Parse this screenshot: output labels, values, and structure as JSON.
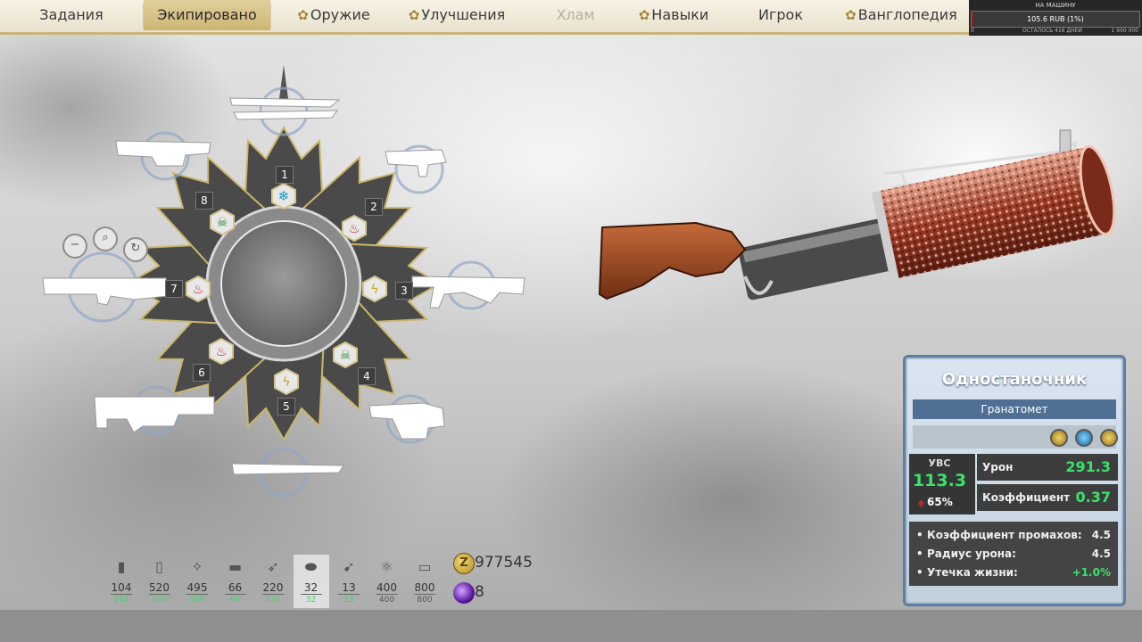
{
  "nav": {
    "tabs": [
      {
        "label": "Задания",
        "icon": ""
      },
      {
        "label": "Экипировано",
        "icon": ""
      },
      {
        "label": "Оружие",
        "icon": "gear-icon"
      },
      {
        "label": "Улучшения",
        "icon": "gear-icon"
      },
      {
        "label": "Хлам",
        "icon": ""
      },
      {
        "label": "Навыки",
        "icon": "gear-icon"
      },
      {
        "label": "Игрок",
        "icon": ""
      },
      {
        "label": "Ванглопедия",
        "icon": "gear-icon"
      }
    ],
    "active": "Экипировано",
    "disabled": "Хлам"
  },
  "donation": {
    "title": "НА МАШИНУ",
    "amount_text": "105.6 RUB (1%)",
    "progress": 0.01,
    "left_value": "0",
    "middle_text": "ОСТАЛОСЬ 416 ДНЕЙ",
    "right_value": "1 900 000",
    "fill_color": "#8b1c1c"
  },
  "wheel": {
    "slots": [
      "1",
      "2",
      "3",
      "4",
      "5",
      "6",
      "7",
      "8"
    ],
    "element_icons": [
      "snowflake-icon",
      "fire-icon",
      "lightning-icon",
      "skull-icon",
      "lightning-icon",
      "fire-icon",
      "fire-icon",
      "skull-icon"
    ],
    "side_buttons": [
      "minus-icon",
      "magnifier-icon",
      "refresh-icon"
    ]
  },
  "weapon": {
    "name": "Одностаночник",
    "type": "Гранатомет",
    "chips": [
      "gold-chip",
      "blue-chip",
      "gold-chip"
    ],
    "ubc_label": "УВС",
    "ubc_value": "113.3",
    "ubc_percent": "65%",
    "stats": [
      {
        "label": "Урон",
        "value": "291.3"
      },
      {
        "label": "Коэффициент",
        "value": "0.37"
      }
    ],
    "details": [
      {
        "label": "Коэффициент промахов:",
        "value": "4.5",
        "highlight": false
      },
      {
        "label": "Радиус урона:",
        "value": "4.5",
        "highlight": false
      },
      {
        "label": "Утечка жизни:",
        "value": "+1.0%",
        "highlight": true
      }
    ],
    "accent_color": "#39e36a"
  },
  "ammo": [
    {
      "icon": "bullet-icon",
      "current": "104",
      "max": "104"
    },
    {
      "icon": "shell-icon",
      "current": "520",
      "max": "520"
    },
    {
      "icon": "rocket-cluster-icon",
      "current": "495",
      "max": "495"
    },
    {
      "icon": "battery-icon",
      "current": "66",
      "max": "66"
    },
    {
      "icon": "plane-icon",
      "current": "220",
      "max": "220"
    },
    {
      "icon": "grenade-icon",
      "current": "32",
      "max": "32"
    },
    {
      "icon": "missile-icon",
      "current": "13",
      "max": "13"
    },
    {
      "icon": "atom-icon",
      "current": "400",
      "max": "400"
    },
    {
      "icon": "cell-icon",
      "current": "800",
      "max": "800"
    }
  ],
  "currency": {
    "coins": "977545",
    "coin_symbol": "Z",
    "orbs": "8"
  }
}
